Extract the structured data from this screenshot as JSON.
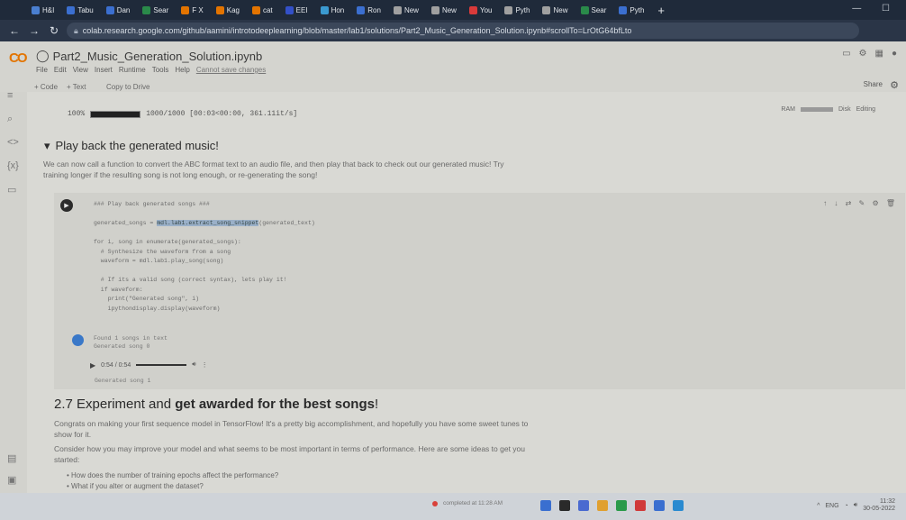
{
  "browser": {
    "tabs": [
      {
        "label": "H&I",
        "color": "#4a7fd0"
      },
      {
        "label": "Tabu",
        "color": "#3b6fd0"
      },
      {
        "label": "Dan",
        "color": "#3b6fd0"
      },
      {
        "label": "Sear",
        "color": "#2a8a4a"
      },
      {
        "label": "F X",
        "color": "#e37400"
      },
      {
        "label": "Kag",
        "color": "#e37400"
      },
      {
        "label": "cat",
        "color": "#e37400"
      },
      {
        "label": "EEI",
        "color": "#3350c8"
      },
      {
        "label": "Hon",
        "color": "#3b9ad0"
      },
      {
        "label": "Ron",
        "color": "#3b6fd0"
      },
      {
        "label": "New",
        "color": "#a0a0a0"
      },
      {
        "label": "New",
        "color": "#a0a0a0"
      },
      {
        "label": "You",
        "color": "#d93a3a"
      },
      {
        "label": "Pyth",
        "color": "#a0a0a0"
      },
      {
        "label": "New",
        "color": "#a0a0a0"
      },
      {
        "label": "Sear",
        "color": "#2a8a4a"
      },
      {
        "label": "Pyth",
        "color": "#3b6fd0"
      }
    ],
    "new_tab": "+",
    "url": "colab.research.google.com/github/aamini/introtodeeplearning/blob/master/lab1/solutions/Part2_Music_Generation_Solution.ipynb#scrollTo=LrOtG64bfLto"
  },
  "colab": {
    "logo": "CO",
    "title": "Part2_Music_Generation_Solution.ipynb",
    "menu": [
      "File",
      "Edit",
      "View",
      "Insert",
      "Runtime",
      "Tools",
      "Help"
    ],
    "saved_status": "Cannot save changes",
    "toolbar": {
      "code": "+ Code",
      "text": "+ Text",
      "copy": "Copy to Drive"
    },
    "share": "Share",
    "ram_label": "RAM",
    "disk_label": "Disk",
    "editing": "Editing"
  },
  "notebook": {
    "progress_out": {
      "left": "100%",
      "right": "1000/1000 [00:03<00:00, 361.11it/s]",
      "fraction": 1.0
    },
    "section_title": "Play back the generated music!",
    "intro_lines": [
      "We can now call a function to convert the ABC format text to an audio file, and then play that back to check out our generated music! Try",
      "training longer if the resulting song is not long enough, or re-generating the song!"
    ],
    "code_lines": [
      "### Play back generated songs ###",
      "",
      "generated_songs = mdl.lab1.extract_song_snippet(generated_text)",
      "",
      "for i, song in enumerate(generated_songs):",
      "  # Synthesize the waveform from a song",
      "  waveform = mdl.lab1.play_song(song)",
      "",
      "  # If its a valid song (correct syntax), lets play it!",
      "  if waveform:",
      "    print(\"Generated song\", i)",
      "    ipythondisplay.display(waveform)"
    ],
    "highlight_token": "mdl.lab1.extract_song_snippet",
    "output_lines": [
      "Found 1 songs in text",
      "Generated song 0"
    ],
    "audio_time": "0:54 / 0:54",
    "caption": "Generated song 1",
    "heading_prefix": "2.7 Experiment and ",
    "heading_bold": "get awarded for the best songs",
    "heading_suffix": "!",
    "para2_lines": [
      "Congrats on making your first sequence model in TensorFlow! It's a pretty big accomplishment, and hopefully you have some sweet tunes to",
      "show for it."
    ],
    "para3_lines": [
      "Consider how you may improve your model and what seems to be most important in terms of performance. Here are some ideas to get you",
      "started:"
    ],
    "bullets": [
      "How does the number of training epochs affect the performance?",
      "What if you alter or augment the dataset?"
    ]
  },
  "taskbar": {
    "status": "completed at 11:28 AM",
    "tray_lang": "ENG",
    "time": "11:32",
    "date": "30-05-2022"
  }
}
